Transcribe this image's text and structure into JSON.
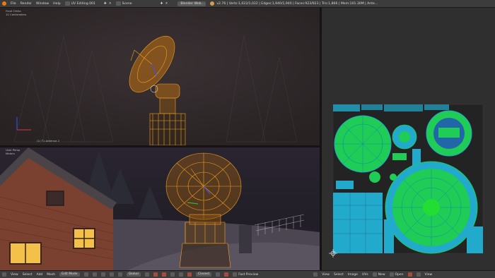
{
  "menu": {
    "file": "File",
    "render": "Render",
    "window": "Window",
    "help": "Help"
  },
  "header": {
    "layout": "UV Editing.001",
    "scene": "Scene",
    "engine": "Blender Web...",
    "stats": "v2.76 | Verts:1,022/1,022 | Edges:1,940/1,940 | Faces:923/923 | Tris:1,866 | Mem:101.30M | Ante..."
  },
  "viewport_top": {
    "view_label": "Front Ortho",
    "units": "10 Centimeters",
    "object_label": "(1) T1 Antenna 2"
  },
  "viewport_bottom": {
    "view_label": "User Persp",
    "units": "Meters"
  },
  "bottom_bar": {
    "view": "View",
    "select": "Select",
    "add": "Add",
    "mesh": "Mesh",
    "mode": "Edit Mode",
    "pivot": "Global",
    "proportional": "Closest",
    "fast_preview": "Fast Preview",
    "uv_view": "View",
    "uv_select": "Select",
    "uv_image": "Image",
    "uv_uvs": "UVs",
    "uv_new": "New",
    "uv_open": "Open",
    "uv_view2": "View"
  },
  "colors": {
    "wire_orange": "#f0a020",
    "uv_green": "#22dd33",
    "uv_cyan": "#22aacc",
    "uv_blue": "#2266aa"
  }
}
